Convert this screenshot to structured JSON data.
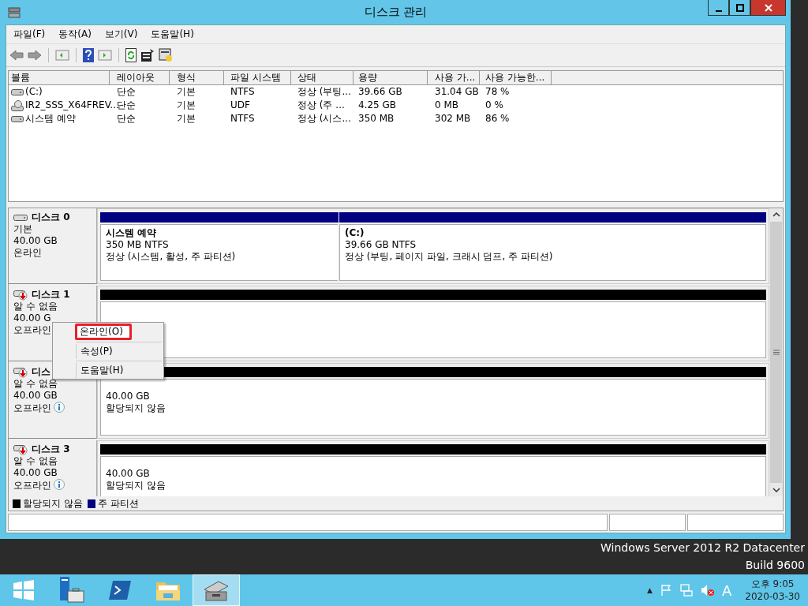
{
  "window": {
    "title": "디스크 관리"
  },
  "menu": [
    "파일(F)",
    "동작(A)",
    "보기(V)",
    "도움말(H)"
  ],
  "table": {
    "columns": [
      "볼륨",
      "레이아웃",
      "형식",
      "파일 시스템",
      "상태",
      "용량",
      "사용 가...",
      "사용 가능한..."
    ],
    "rows": [
      {
        "kind": "drive",
        "cells": [
          "(C:)",
          "단순",
          "기본",
          "NTFS",
          "정상 (부팅...",
          "39.66 GB",
          "31.04 GB",
          "78 %"
        ]
      },
      {
        "kind": "disc",
        "cells": [
          "IR2_SSS_X64FREV...",
          "단순",
          "기본",
          "UDF",
          "정상 (주 ...",
          "4.25 GB",
          "0 MB",
          "0 %"
        ]
      },
      {
        "kind": "drive",
        "cells": [
          "시스템 예약",
          "단순",
          "기본",
          "NTFS",
          "정상 (시스...",
          "350 MB",
          "302 MB",
          "86 %"
        ]
      }
    ]
  },
  "disks": [
    {
      "kind": "online",
      "name": "디스크 0",
      "type": "기본",
      "size": "40.00 GB",
      "status": "온라인",
      "info": false,
      "partitions": [
        {
          "kind": "primary",
          "name": "시스템 예약",
          "size": "350 MB NTFS",
          "state": "정상 (시스템, 활성, 주 파티션)"
        },
        {
          "kind": "primary",
          "name": "(C:)",
          "size": "39.66 GB NTFS",
          "state": "정상 (부팅, 페이지 파일, 크래시 덤프, 주 파티션)"
        }
      ]
    },
    {
      "kind": "offline",
      "name": "디스크 1",
      "type": "알 수 없음",
      "size": "40.00 G",
      "status": "오프라인",
      "info": false,
      "partitions": [
        {
          "kind": "unallocated"
        }
      ]
    },
    {
      "kind": "offline",
      "name": "디스",
      "type": "알 수 없음",
      "size": "40.00 GB",
      "status": "오프라인",
      "info": true,
      "partitions": [
        {
          "kind": "unallocated",
          "size": "40.00 GB",
          "state": "할당되지 않음"
        }
      ]
    },
    {
      "kind": "offline",
      "name": "디스크 3",
      "type": "알 수 없음",
      "size": "40.00 GB",
      "status": "오프라인",
      "info": true,
      "partitions": [
        {
          "kind": "unallocated",
          "size": "40.00 GB",
          "state": "할당되지 않음"
        }
      ]
    }
  ],
  "legend": [
    {
      "label": "할당되지 않음",
      "color": "#000000"
    },
    {
      "label": "주 파티션",
      "color": "#000080"
    }
  ],
  "context_menu": [
    {
      "label": "온라인(O)",
      "highlighted": true
    },
    {
      "label": "속성(P)",
      "highlighted": false
    },
    {
      "label": "도움말(H)",
      "highlighted": false
    }
  ],
  "desktop": {
    "edition": "Windows Server 2012 R2 Datacenter",
    "build": "Build 9600"
  },
  "taskbar": {
    "apps": [
      {
        "kind": "start",
        "selected": false
      },
      {
        "kind": "server",
        "selected": false
      },
      {
        "kind": "shell",
        "selected": false
      },
      {
        "kind": "folder",
        "selected": false
      },
      {
        "kind": "diskmgmt",
        "selected": true
      }
    ],
    "tray_arrow": "▲",
    "ime": "A",
    "time": "오후 9:05",
    "date": "2020-03-30"
  }
}
